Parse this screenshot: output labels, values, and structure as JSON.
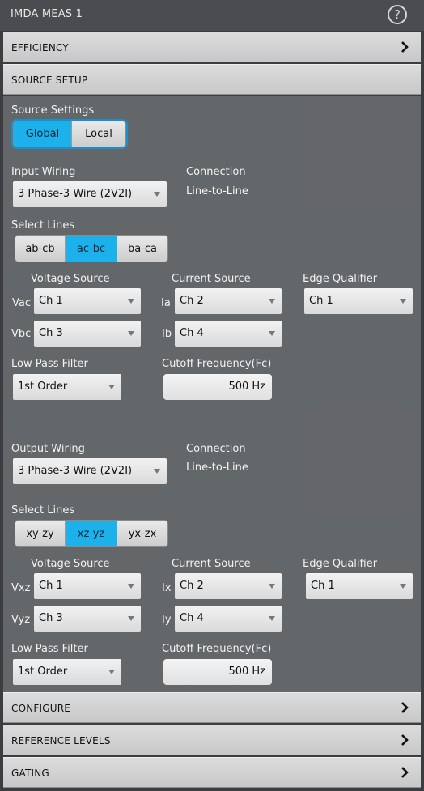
{
  "window": {
    "title": "IMDA MEAS 1",
    "help_icon": "?"
  },
  "sections": {
    "efficiency": "EFFICIENCY",
    "source_setup": "SOURCE SETUP",
    "configure": "CONFIGURE",
    "reference_levels": "REFERENCE LEVELS",
    "gating": "GATING"
  },
  "source_settings": {
    "label": "Source Settings",
    "options": [
      "Global",
      "Local"
    ],
    "selected": "Global"
  },
  "input": {
    "wiring_label": "Input Wiring",
    "wiring_value": "3 Phase-3 Wire (2V2I)",
    "connection_label": "Connection",
    "connection_value": "Line-to-Line",
    "select_lines_label": "Select Lines",
    "lines": [
      "ab-cb",
      "ac-bc",
      "ba-ca"
    ],
    "lines_selected": "ac-bc",
    "voltage_source_label": "Voltage Source",
    "current_source_label": "Current Source",
    "edge_qualifier_label": "Edge Qualifier",
    "v1_label": "Vac",
    "v1_value": "Ch 1",
    "v2_label": "Vbc",
    "v2_value": "Ch 3",
    "i1_label": "Ia",
    "i1_value": "Ch 2",
    "i2_label": "Ib",
    "i2_value": "Ch 4",
    "edge_value": "Ch 1",
    "lpf_label": "Low Pass Filter",
    "lpf_value": "1st Order",
    "cutoff_label": "Cutoff Frequency(Fc)",
    "cutoff_value": "500 Hz"
  },
  "output": {
    "wiring_label": "Output Wiring",
    "wiring_value": "3 Phase-3 Wire (2V2I)",
    "connection_label": "Connection",
    "connection_value": "Line-to-Line",
    "select_lines_label": "Select Lines",
    "lines": [
      "xy-zy",
      "xz-yz",
      "yx-zx"
    ],
    "lines_selected": "xz-yz",
    "voltage_source_label": "Voltage Source",
    "current_source_label": "Current Source",
    "edge_qualifier_label": "Edge Qualifier",
    "v1_label": "Vxz",
    "v1_value": "Ch 1",
    "v2_label": "Vyz",
    "v2_value": "Ch 3",
    "i1_label": "Ix",
    "i1_value": "Ch 2",
    "i2_label": "Iy",
    "i2_value": "Ch 4",
    "edge_value": "Ch 1",
    "lpf_label": "Low Pass Filter",
    "lpf_value": "1st Order",
    "cutoff_label": "Cutoff Frequency(Fc)",
    "cutoff_value": "500 Hz"
  },
  "colors": {
    "accent": "#1db1ec",
    "panel_bg": "#686a6c",
    "header_bg": "#d2d2d2"
  }
}
